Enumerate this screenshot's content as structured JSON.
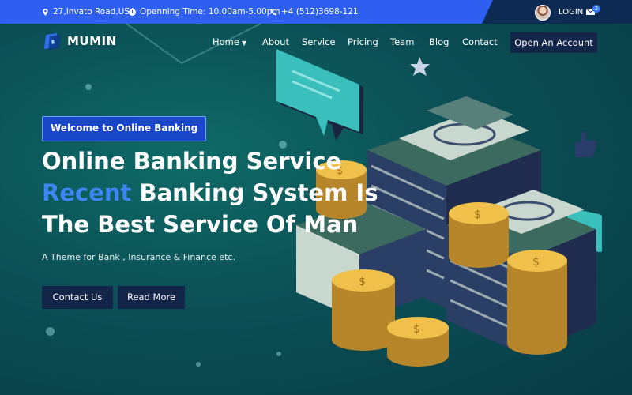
{
  "topbar": {
    "address": "27,Invato Road,USA",
    "hours": "Openning Time: 10.00am-5.00pm",
    "phone": "+4 (512)3698-121",
    "login_label": "LOGIN",
    "mail_count": "2"
  },
  "brand": {
    "name": "MUMIN"
  },
  "nav": {
    "items": [
      {
        "label": "Home",
        "has_dropdown": true
      },
      {
        "label": "About"
      },
      {
        "label": "Service"
      },
      {
        "label": "Pricing"
      },
      {
        "label": "Team"
      },
      {
        "label": "Blog"
      },
      {
        "label": "Contact"
      }
    ],
    "cta_label": "Open An Account"
  },
  "hero": {
    "badge": "Welcome to Online Banking",
    "line1": "Online Banking Service",
    "line2_accent": "Recent",
    "line2_rest": " Banking System Is",
    "line3": "The Best Service Of Man",
    "subtitle": "A Theme for Bank , Insurance & Finance etc.",
    "contact_button": "Contact Us",
    "read_button": "Read More"
  },
  "colors": {
    "topbar": "#2f5ff0",
    "topbar_dark": "#0d2a52",
    "accent": "#3e86f5",
    "button_bg": "#14254a",
    "background": "#0b4f55"
  },
  "icons": [
    "location-icon",
    "clock-icon",
    "phone-icon",
    "mail-icon",
    "logo-icon",
    "chevron-down-icon",
    "star-icon",
    "thumbs-up-icon",
    "chat-bubble-icon"
  ]
}
